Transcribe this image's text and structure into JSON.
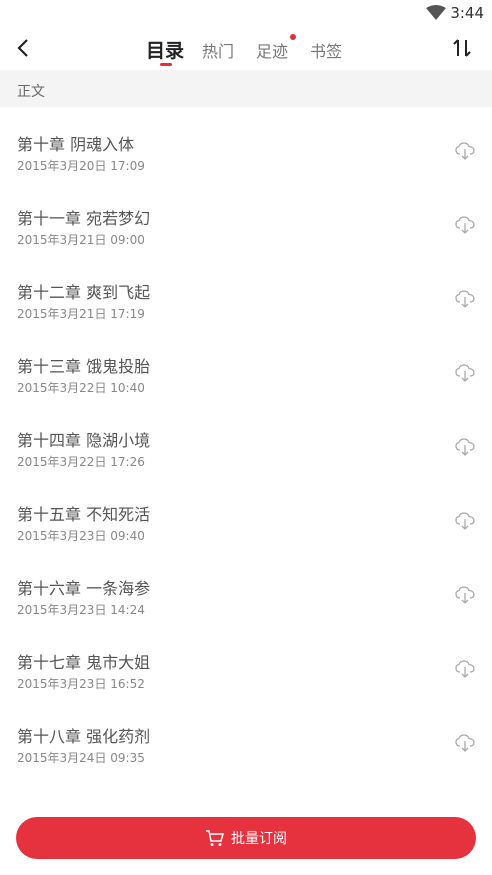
{
  "status": {
    "time": "3:44"
  },
  "nav": {
    "tabs": [
      {
        "label": "目录",
        "active": true
      },
      {
        "label": "热门",
        "active": false
      },
      {
        "label": "足迹",
        "active": false,
        "has_badge": true
      },
      {
        "label": "书签",
        "active": false
      }
    ],
    "accent": "#e0303b"
  },
  "section": {
    "label": "正文"
  },
  "chapters": [
    {
      "title": "第十章 阴魂入体",
      "date": "2015年3月20日 17:09"
    },
    {
      "title": "第十一章 宛若梦幻",
      "date": "2015年3月21日 09:00"
    },
    {
      "title": "第十二章 爽到飞起",
      "date": "2015年3月21日 17:19"
    },
    {
      "title": "第十三章 饿鬼投胎",
      "date": "2015年3月22日 10:40"
    },
    {
      "title": "第十四章 隐湖小境",
      "date": "2015年3月22日 17:26"
    },
    {
      "title": "第十五章 不知死活",
      "date": "2015年3月23日 09:40"
    },
    {
      "title": "第十六章 一条海参",
      "date": "2015年3月23日 14:24"
    },
    {
      "title": "第十七章 鬼市大姐",
      "date": "2015年3月23日 16:52"
    },
    {
      "title": "第十八章 强化药剂",
      "date": "2015年3月24日 09:35"
    }
  ],
  "bottom": {
    "label": "批量订阅",
    "color": "#e5323e"
  }
}
